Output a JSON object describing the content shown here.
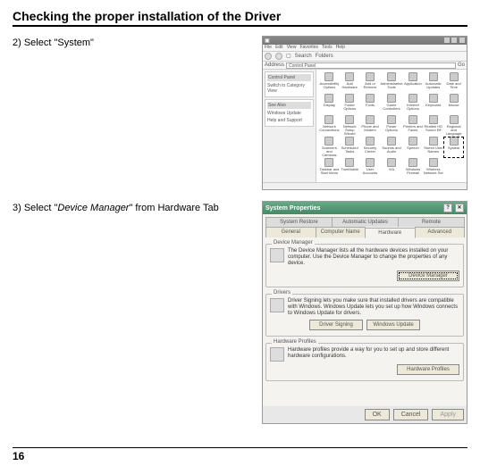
{
  "page": {
    "title": "Checking the proper installation of the Driver",
    "number": "16"
  },
  "steps": {
    "s2": "2) Select \"System\"",
    "s3_pre": "3) Select \"",
    "s3_em": "Device Manager",
    "s3_post": "\" from Hardware Tab"
  },
  "cp": {
    "menus": [
      "File",
      "Edit",
      "View",
      "Favorites",
      "Tools",
      "Help"
    ],
    "search": "Search",
    "folders": "Folders",
    "address_label": "Address",
    "address_value": "Control Panel",
    "go": "Go",
    "panel1_head": "Control Panel",
    "panel1_link": "Switch to Category View",
    "panel2_head": "See Also",
    "panel2_link1": "Windows Update",
    "panel2_link2": "Help and Support",
    "icons": [
      "Accessibility Options",
      "Add Hardware",
      "Add or Remove",
      "Administrative Tools",
      "Application",
      "Automatic Updates",
      "Date and Time",
      "Display",
      "Folder Options",
      "Fonts",
      "Game Controllers",
      "Internet Options",
      "Keyboard",
      "Mouse",
      "Network Connections",
      "Network Setup Wizard",
      "Phone and Modem",
      "Power Options",
      "Printers and Faxes",
      "Realtek HD Sound Eff",
      "Regional and Language",
      "Scanners and Cameras",
      "Scheduled Tasks",
      "Security Center",
      "Sounds and Audio",
      "Speech",
      "Stored User Names",
      "System",
      "Taskbar and Start Menu",
      "TrueMobile",
      "User Accounts",
      "VIA",
      "Windows Firewall",
      "Wireless Network Set"
    ],
    "highlight_index": 27
  },
  "sp": {
    "title": "System Properties",
    "tabs_row1": [
      "System Restore",
      "Automatic Updates",
      "Remote"
    ],
    "tabs_row2": [
      "General",
      "Computer Name",
      "Hardware",
      "Advanced"
    ],
    "active_tab": "Hardware",
    "grp_devmgr": {
      "legend": "Device Manager",
      "text": "The Device Manager lists all the hardware devices installed on your computer. Use the Device Manager to change the properties of any device.",
      "btn": "Device Manager"
    },
    "grp_drivers": {
      "legend": "Drivers",
      "text": "Driver Signing lets you make sure that installed drivers are compatible with Windows. Windows Update lets you set up how Windows connects to Windows Update for drivers.",
      "btn1": "Driver Signing",
      "btn2": "Windows Update"
    },
    "grp_profiles": {
      "legend": "Hardware Profiles",
      "text": "Hardware profiles provide a way for you to set up and store different hardware configurations.",
      "btn": "Hardware Profiles"
    },
    "dlg": {
      "ok": "OK",
      "cancel": "Cancel",
      "apply": "Apply"
    }
  }
}
